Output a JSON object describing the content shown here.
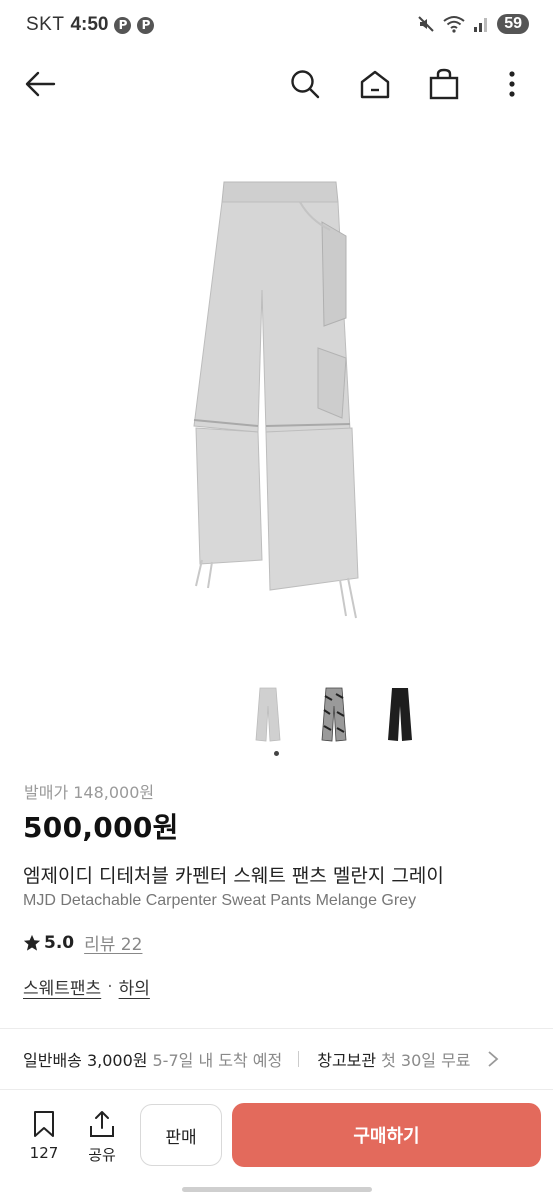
{
  "status_bar": {
    "carrier": "SKT",
    "time": "4:50",
    "notification_icons": [
      "pinterest-icon",
      "pinterest-icon"
    ],
    "battery": "59"
  },
  "nav": {
    "icons": [
      "back-arrow-icon",
      "search-icon",
      "home-icon",
      "shopping-bag-icon",
      "more-vertical-icon"
    ]
  },
  "product": {
    "original_price": "발매가 148,000원",
    "price": "500,000원",
    "title_ko": "엠제이디 디테처블 카펜터 스웨트 팬츠 멜란지 그레이",
    "title_en": "MJD Detachable Carpenter Sweat Pants Melange Grey",
    "rating": "5.0",
    "review_label": "리뷰 22",
    "tags": [
      "스웨트팬츠",
      "하의"
    ],
    "tag_separator": "·",
    "image_count": 3,
    "active_image": 1
  },
  "shipping": {
    "label": "일반배송 3,000원",
    "sub": "5-7일 내 도착 예정",
    "storage_label": "창고보관",
    "storage_sub": "첫 30일 무료"
  },
  "bottom_bar": {
    "bookmark_count": "127",
    "share_label": "공유",
    "sell_label": "판매",
    "buy_label": "구매하기"
  },
  "colors": {
    "buy_button": "#e36a5c",
    "pants_grey": "#d4d4d4"
  }
}
